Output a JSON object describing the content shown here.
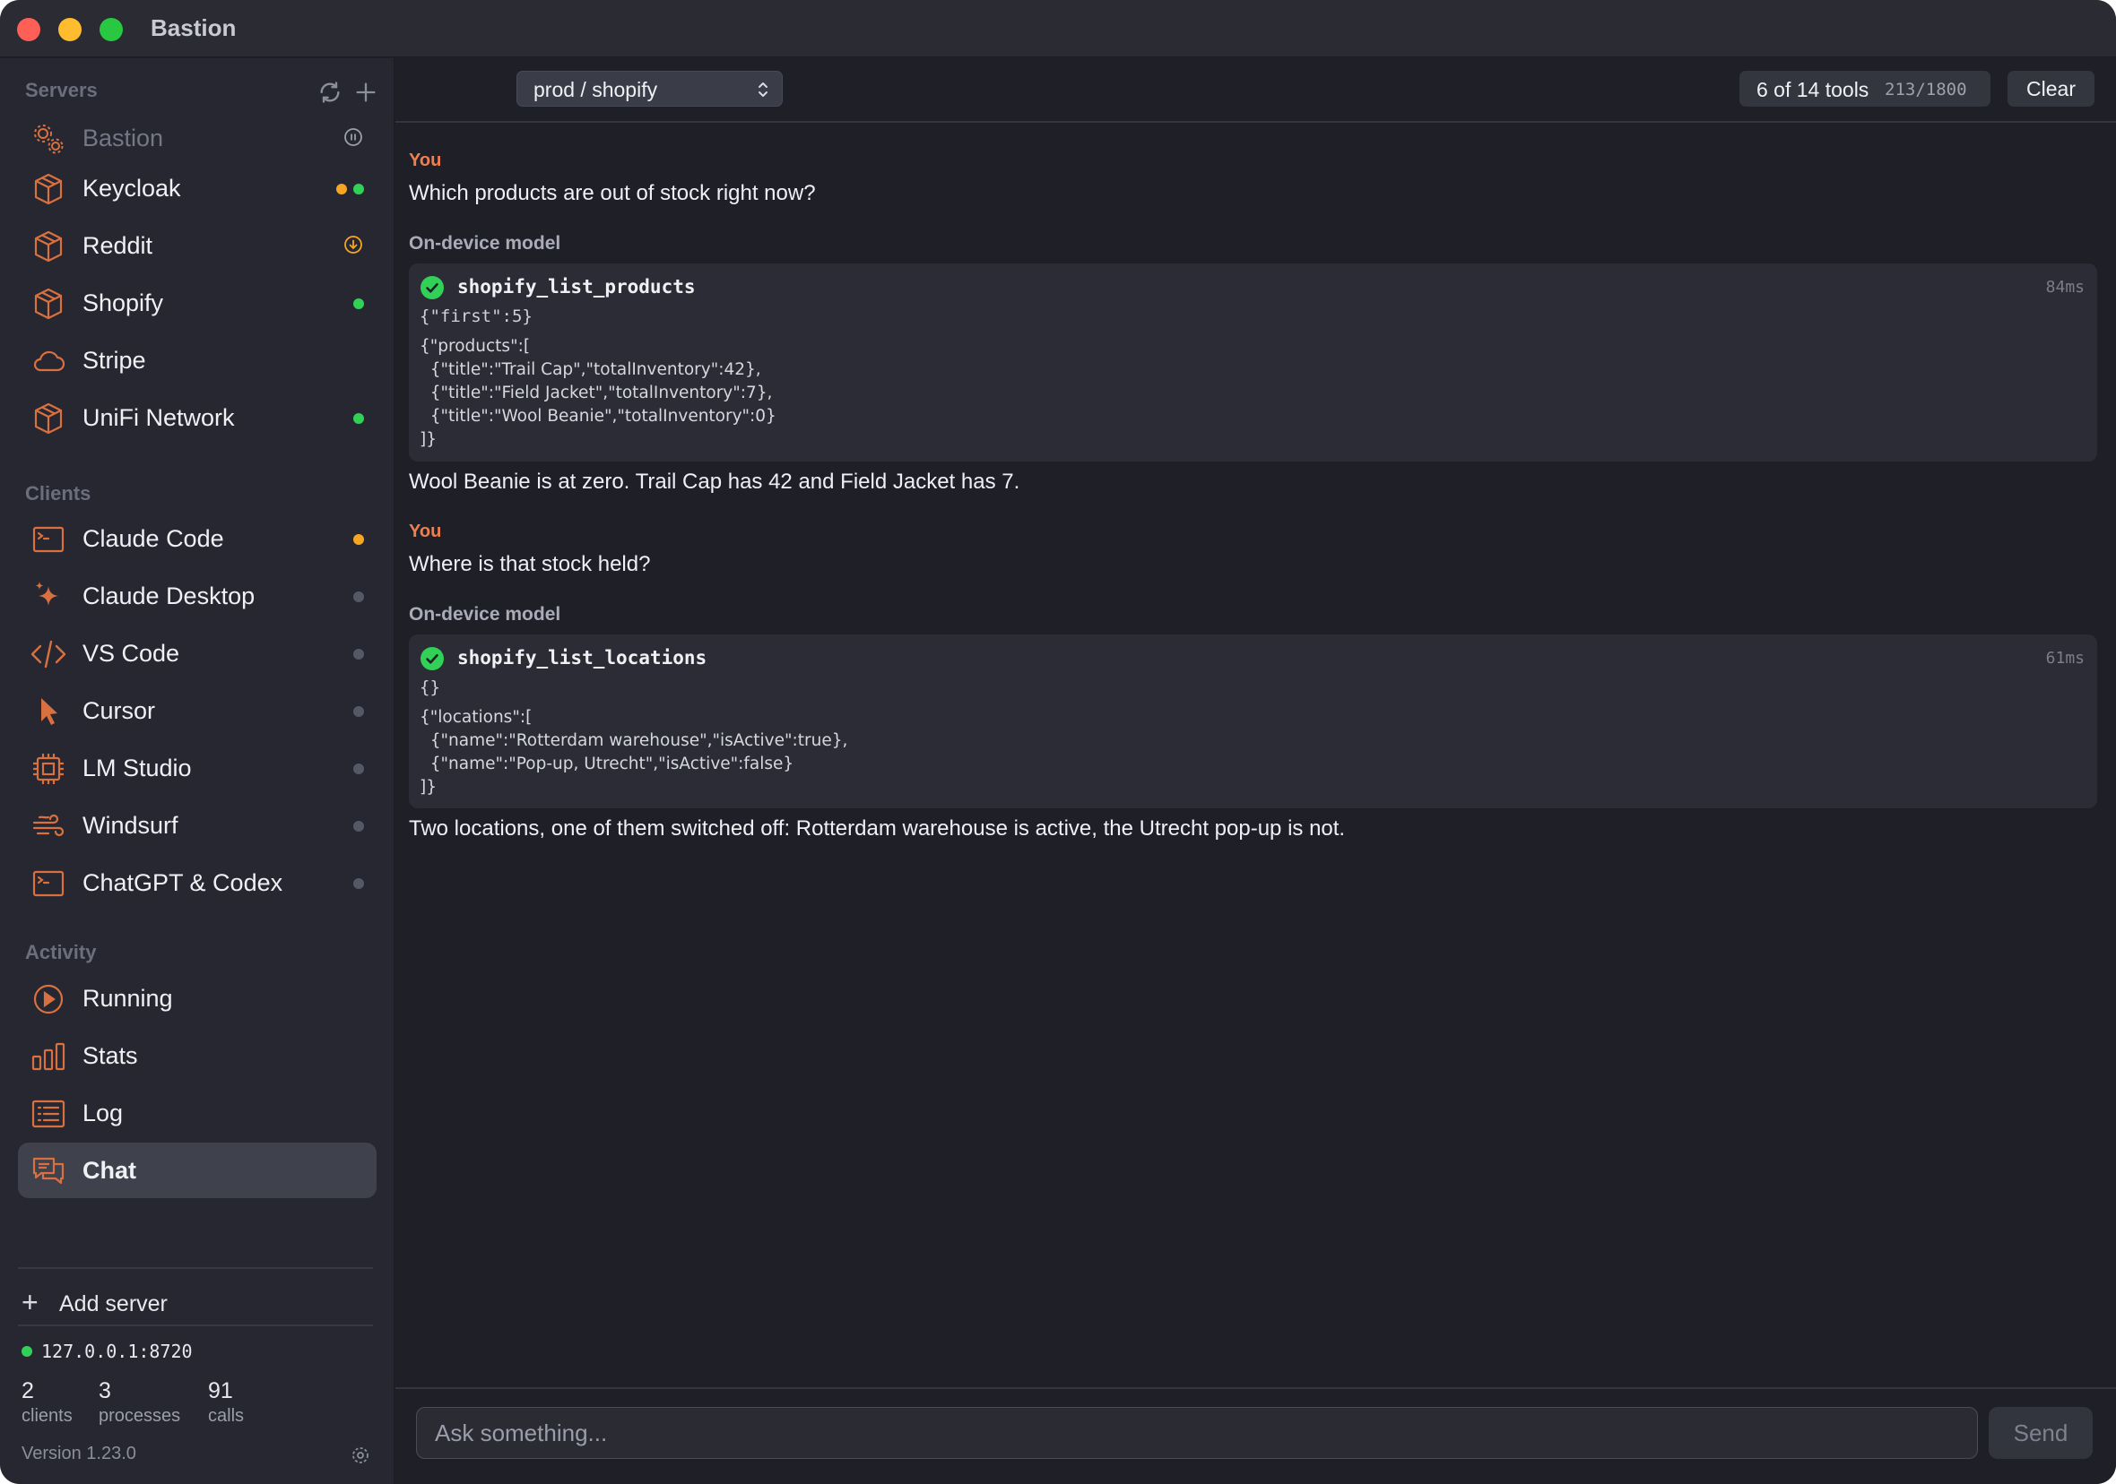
{
  "app": {
    "title": "Bastion"
  },
  "sidebar": {
    "servers_title": "Servers",
    "servers": [
      {
        "label": "Bastion",
        "icon": "gears-icon",
        "status": "paused"
      },
      {
        "label": "Keycloak",
        "icon": "cube-icon",
        "status": "orange+green"
      },
      {
        "label": "Reddit",
        "icon": "cube-icon",
        "status": "download"
      },
      {
        "label": "Shopify",
        "icon": "cube-icon",
        "status": "green"
      },
      {
        "label": "Stripe",
        "icon": "cloud-icon",
        "status": "none"
      },
      {
        "label": "UniFi Network",
        "icon": "cube-icon",
        "status": "green"
      }
    ],
    "clients_title": "Clients",
    "clients": [
      {
        "label": "Claude Code",
        "icon": "terminal-icon",
        "status": "orange"
      },
      {
        "label": "Claude Desktop",
        "icon": "sparkle-icon",
        "status": "gray"
      },
      {
        "label": "VS Code",
        "icon": "code-icon",
        "status": "gray"
      },
      {
        "label": "Cursor",
        "icon": "cursor-icon",
        "status": "gray"
      },
      {
        "label": "LM Studio",
        "icon": "chip-icon",
        "status": "gray"
      },
      {
        "label": "Windsurf",
        "icon": "wind-icon",
        "status": "gray"
      },
      {
        "label": "ChatGPT & Codex",
        "icon": "terminal-icon",
        "status": "gray"
      }
    ],
    "activity_title": "Activity",
    "activity": [
      {
        "label": "Running",
        "icon": "play-icon"
      },
      {
        "label": "Stats",
        "icon": "bar-chart-icon"
      },
      {
        "label": "Log",
        "icon": "list-icon"
      },
      {
        "label": "Chat",
        "icon": "chat-icon",
        "active": true
      }
    ],
    "add_server_label": "Add server",
    "address": "127.0.0.1:8720",
    "stats": [
      {
        "value": "2",
        "caption": "clients"
      },
      {
        "value": "3",
        "caption": "processes"
      },
      {
        "value": "91",
        "caption": "calls"
      }
    ],
    "version": "Version 1.23.0"
  },
  "toolbar": {
    "selected_server": "prod / shopify",
    "tools_count": "6 of 14 tools",
    "tokens": "213/1800",
    "clear_label": "Clear"
  },
  "chat": {
    "you_label": "You",
    "model_label": "On-device model",
    "q1": "Which products are out of stock right now?",
    "tool1": {
      "name": "shopify_list_products",
      "duration": "84ms",
      "args": "{\"first\":5}",
      "result": "{\"products\":[\n  {\"title\":\"Trail Cap\",\"totalInventory\":42},\n  {\"title\":\"Field Jacket\",\"totalInventory\":7},\n  {\"title\":\"Wool Beanie\",\"totalInventory\":0}\n]}"
    },
    "a1": "Wool Beanie is at zero. Trail Cap has 42 and Field Jacket has 7.",
    "q2": "Where is that stock held?",
    "tool2": {
      "name": "shopify_list_locations",
      "duration": "61ms",
      "args": "{}",
      "result": "{\"locations\":[\n  {\"name\":\"Rotterdam warehouse\",\"isActive\":true},\n  {\"name\":\"Pop-up, Utrecht\",\"isActive\":false}\n]}"
    },
    "a2": "Two locations, one of them switched off: Rotterdam warehouse is active, the Utrecht pop-up is not."
  },
  "composer": {
    "placeholder": "Ask something...",
    "send_label": "Send"
  },
  "colors": {
    "accent": "#f07f4f",
    "status_green": "#31d158",
    "status_orange": "#f5a623",
    "background": "#1f2027",
    "sidebar": "#262730"
  }
}
